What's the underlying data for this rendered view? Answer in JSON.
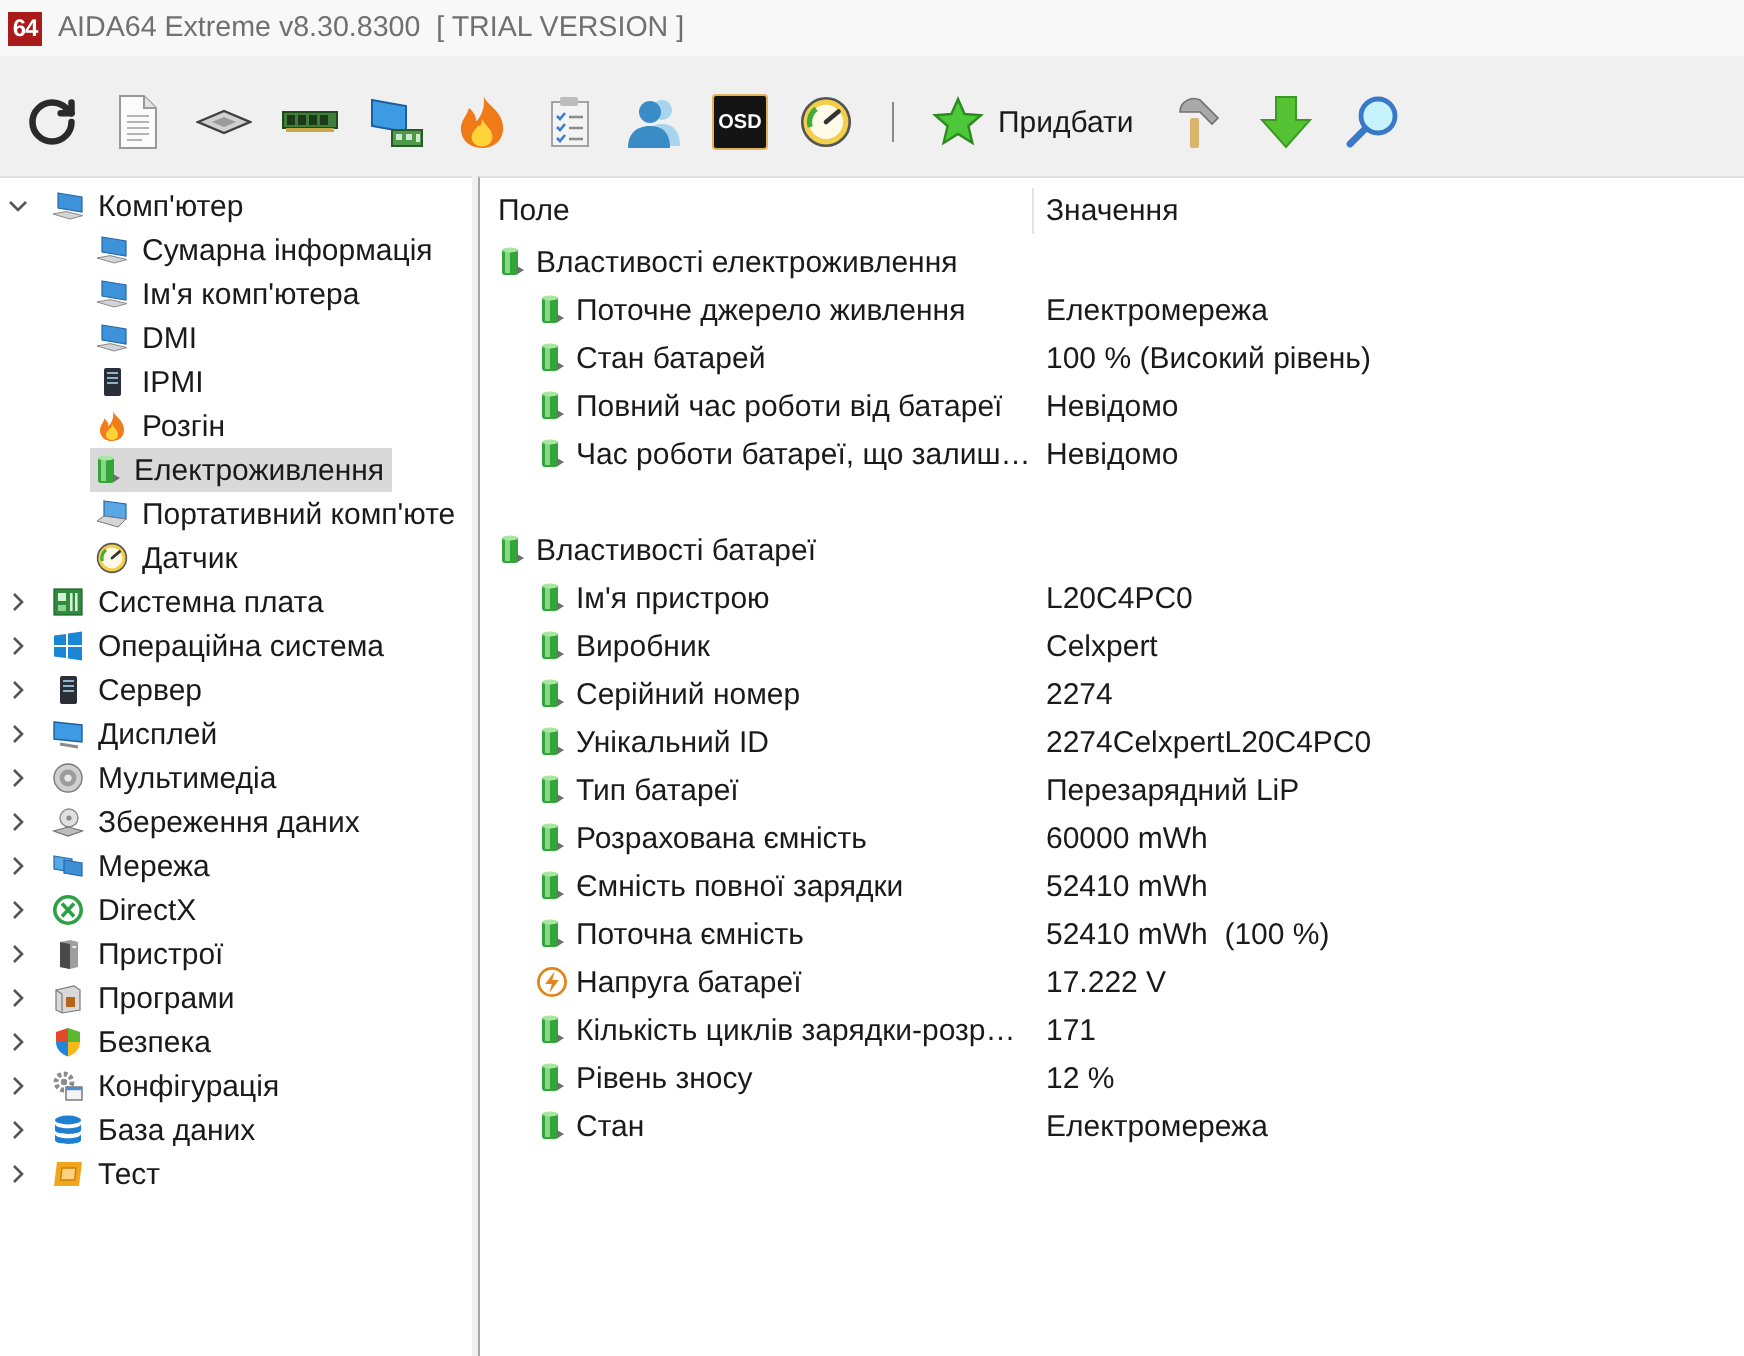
{
  "window": {
    "logo": "64",
    "title": "AIDA64 Extreme v8.30.8300  [ TRIAL VERSION ]"
  },
  "toolbar": {
    "osd_label": "OSD",
    "buy_label": "Придбати"
  },
  "sidebar": {
    "items": [
      {
        "label": "Комп'ютер",
        "expanded": true,
        "selected": false,
        "children": [
          {
            "label": "Сумарна інформація",
            "selected": false
          },
          {
            "label": "Ім'я комп'ютера",
            "selected": false
          },
          {
            "label": "DMI",
            "selected": false
          },
          {
            "label": "IPMI",
            "selected": false
          },
          {
            "label": "Розгін",
            "selected": false
          },
          {
            "label": "Електроживлення",
            "selected": true
          },
          {
            "label": "Портативний комп'юте",
            "selected": false
          },
          {
            "label": "Датчик",
            "selected": false
          }
        ]
      },
      {
        "label": "Системна плата",
        "expanded": false,
        "selected": false
      },
      {
        "label": "Операційна система",
        "expanded": false,
        "selected": false
      },
      {
        "label": "Сервер",
        "expanded": false,
        "selected": false
      },
      {
        "label": "Дисплей",
        "expanded": false,
        "selected": false
      },
      {
        "label": "Мультимедіа",
        "expanded": false,
        "selected": false
      },
      {
        "label": "Збереження даних",
        "expanded": false,
        "selected": false
      },
      {
        "label": "Мережа",
        "expanded": false,
        "selected": false
      },
      {
        "label": "DirectX",
        "expanded": false,
        "selected": false
      },
      {
        "label": "Пристрої",
        "expanded": false,
        "selected": false
      },
      {
        "label": "Програми",
        "expanded": false,
        "selected": false
      },
      {
        "label": "Безпека",
        "expanded": false,
        "selected": false
      },
      {
        "label": "Конфігурація",
        "expanded": false,
        "selected": false
      },
      {
        "label": "База даних",
        "expanded": false,
        "selected": false
      },
      {
        "label": "Тест",
        "expanded": false,
        "selected": false
      }
    ]
  },
  "table": {
    "columns": [
      "Поле",
      "Значення"
    ],
    "groups": [
      {
        "title": "Властивості електроживлення",
        "rows": [
          {
            "kind": "power",
            "field": "Поточне джерело живлення",
            "value": "Електромережа"
          },
          {
            "kind": "power",
            "field": "Стан батарей",
            "value": "100 % (Високий рівень)"
          },
          {
            "kind": "power",
            "field": "Повний час роботи від батареї",
            "value": "Невідомо"
          },
          {
            "kind": "power",
            "field": "Час роботи батареї, що залиш…",
            "value": "Невідомо"
          }
        ]
      },
      {
        "title": "Властивості батареї",
        "rows": [
          {
            "kind": "power",
            "field": "Ім'я пристрою",
            "value": "L20C4PC0"
          },
          {
            "kind": "power",
            "field": "Виробник",
            "value": "Celxpert"
          },
          {
            "kind": "power",
            "field": "Серійний номер",
            "value": "2274"
          },
          {
            "kind": "power",
            "field": "Унікальний ID",
            "value": "2274CelxpertL20C4PC0"
          },
          {
            "kind": "power",
            "field": "Тип батареї",
            "value": "Перезарядний LiP"
          },
          {
            "kind": "power",
            "field": "Розрахована ємність",
            "value": "60000 mWh"
          },
          {
            "kind": "power",
            "field": "Ємність повної зарядки",
            "value": "52410 mWh"
          },
          {
            "kind": "power",
            "field": "Поточна ємність",
            "value": "52410 mWh  (100 %)"
          },
          {
            "kind": "voltage",
            "field": "Напруга батареї",
            "value": "17.222 V"
          },
          {
            "kind": "power",
            "field": "Кількість циклів зарядки-розр…",
            "value": "171"
          },
          {
            "kind": "power",
            "field": "Рівень зносу",
            "value": "12 %"
          },
          {
            "kind": "power",
            "field": "Стан",
            "value": "Електромережа"
          }
        ]
      }
    ]
  }
}
